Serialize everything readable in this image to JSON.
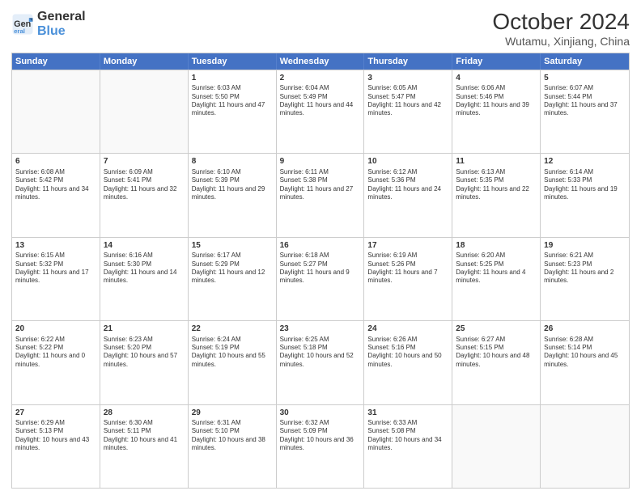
{
  "logo": {
    "text_general": "General",
    "text_blue": "Blue"
  },
  "header": {
    "month": "October 2024",
    "location": "Wutamu, Xinjiang, China"
  },
  "days_of_week": [
    "Sunday",
    "Monday",
    "Tuesday",
    "Wednesday",
    "Thursday",
    "Friday",
    "Saturday"
  ],
  "weeks": [
    [
      {
        "day": "",
        "empty": true
      },
      {
        "day": "",
        "empty": true
      },
      {
        "day": "1",
        "sunrise": "Sunrise: 6:03 AM",
        "sunset": "Sunset: 5:50 PM",
        "daylight": "Daylight: 11 hours and 47 minutes."
      },
      {
        "day": "2",
        "sunrise": "Sunrise: 6:04 AM",
        "sunset": "Sunset: 5:49 PM",
        "daylight": "Daylight: 11 hours and 44 minutes."
      },
      {
        "day": "3",
        "sunrise": "Sunrise: 6:05 AM",
        "sunset": "Sunset: 5:47 PM",
        "daylight": "Daylight: 11 hours and 42 minutes."
      },
      {
        "day": "4",
        "sunrise": "Sunrise: 6:06 AM",
        "sunset": "Sunset: 5:46 PM",
        "daylight": "Daylight: 11 hours and 39 minutes."
      },
      {
        "day": "5",
        "sunrise": "Sunrise: 6:07 AM",
        "sunset": "Sunset: 5:44 PM",
        "daylight": "Daylight: 11 hours and 37 minutes."
      }
    ],
    [
      {
        "day": "6",
        "sunrise": "Sunrise: 6:08 AM",
        "sunset": "Sunset: 5:42 PM",
        "daylight": "Daylight: 11 hours and 34 minutes."
      },
      {
        "day": "7",
        "sunrise": "Sunrise: 6:09 AM",
        "sunset": "Sunset: 5:41 PM",
        "daylight": "Daylight: 11 hours and 32 minutes."
      },
      {
        "day": "8",
        "sunrise": "Sunrise: 6:10 AM",
        "sunset": "Sunset: 5:39 PM",
        "daylight": "Daylight: 11 hours and 29 minutes."
      },
      {
        "day": "9",
        "sunrise": "Sunrise: 6:11 AM",
        "sunset": "Sunset: 5:38 PM",
        "daylight": "Daylight: 11 hours and 27 minutes."
      },
      {
        "day": "10",
        "sunrise": "Sunrise: 6:12 AM",
        "sunset": "Sunset: 5:36 PM",
        "daylight": "Daylight: 11 hours and 24 minutes."
      },
      {
        "day": "11",
        "sunrise": "Sunrise: 6:13 AM",
        "sunset": "Sunset: 5:35 PM",
        "daylight": "Daylight: 11 hours and 22 minutes."
      },
      {
        "day": "12",
        "sunrise": "Sunrise: 6:14 AM",
        "sunset": "Sunset: 5:33 PM",
        "daylight": "Daylight: 11 hours and 19 minutes."
      }
    ],
    [
      {
        "day": "13",
        "sunrise": "Sunrise: 6:15 AM",
        "sunset": "Sunset: 5:32 PM",
        "daylight": "Daylight: 11 hours and 17 minutes."
      },
      {
        "day": "14",
        "sunrise": "Sunrise: 6:16 AM",
        "sunset": "Sunset: 5:30 PM",
        "daylight": "Daylight: 11 hours and 14 minutes."
      },
      {
        "day": "15",
        "sunrise": "Sunrise: 6:17 AM",
        "sunset": "Sunset: 5:29 PM",
        "daylight": "Daylight: 11 hours and 12 minutes."
      },
      {
        "day": "16",
        "sunrise": "Sunrise: 6:18 AM",
        "sunset": "Sunset: 5:27 PM",
        "daylight": "Daylight: 11 hours and 9 minutes."
      },
      {
        "day": "17",
        "sunrise": "Sunrise: 6:19 AM",
        "sunset": "Sunset: 5:26 PM",
        "daylight": "Daylight: 11 hours and 7 minutes."
      },
      {
        "day": "18",
        "sunrise": "Sunrise: 6:20 AM",
        "sunset": "Sunset: 5:25 PM",
        "daylight": "Daylight: 11 hours and 4 minutes."
      },
      {
        "day": "19",
        "sunrise": "Sunrise: 6:21 AM",
        "sunset": "Sunset: 5:23 PM",
        "daylight": "Daylight: 11 hours and 2 minutes."
      }
    ],
    [
      {
        "day": "20",
        "sunrise": "Sunrise: 6:22 AM",
        "sunset": "Sunset: 5:22 PM",
        "daylight": "Daylight: 11 hours and 0 minutes."
      },
      {
        "day": "21",
        "sunrise": "Sunrise: 6:23 AM",
        "sunset": "Sunset: 5:20 PM",
        "daylight": "Daylight: 10 hours and 57 minutes."
      },
      {
        "day": "22",
        "sunrise": "Sunrise: 6:24 AM",
        "sunset": "Sunset: 5:19 PM",
        "daylight": "Daylight: 10 hours and 55 minutes."
      },
      {
        "day": "23",
        "sunrise": "Sunrise: 6:25 AM",
        "sunset": "Sunset: 5:18 PM",
        "daylight": "Daylight: 10 hours and 52 minutes."
      },
      {
        "day": "24",
        "sunrise": "Sunrise: 6:26 AM",
        "sunset": "Sunset: 5:16 PM",
        "daylight": "Daylight: 10 hours and 50 minutes."
      },
      {
        "day": "25",
        "sunrise": "Sunrise: 6:27 AM",
        "sunset": "Sunset: 5:15 PM",
        "daylight": "Daylight: 10 hours and 48 minutes."
      },
      {
        "day": "26",
        "sunrise": "Sunrise: 6:28 AM",
        "sunset": "Sunset: 5:14 PM",
        "daylight": "Daylight: 10 hours and 45 minutes."
      }
    ],
    [
      {
        "day": "27",
        "sunrise": "Sunrise: 6:29 AM",
        "sunset": "Sunset: 5:13 PM",
        "daylight": "Daylight: 10 hours and 43 minutes."
      },
      {
        "day": "28",
        "sunrise": "Sunrise: 6:30 AM",
        "sunset": "Sunset: 5:11 PM",
        "daylight": "Daylight: 10 hours and 41 minutes."
      },
      {
        "day": "29",
        "sunrise": "Sunrise: 6:31 AM",
        "sunset": "Sunset: 5:10 PM",
        "daylight": "Daylight: 10 hours and 38 minutes."
      },
      {
        "day": "30",
        "sunrise": "Sunrise: 6:32 AM",
        "sunset": "Sunset: 5:09 PM",
        "daylight": "Daylight: 10 hours and 36 minutes."
      },
      {
        "day": "31",
        "sunrise": "Sunrise: 6:33 AM",
        "sunset": "Sunset: 5:08 PM",
        "daylight": "Daylight: 10 hours and 34 minutes."
      },
      {
        "day": "",
        "empty": true
      },
      {
        "day": "",
        "empty": true
      }
    ]
  ]
}
